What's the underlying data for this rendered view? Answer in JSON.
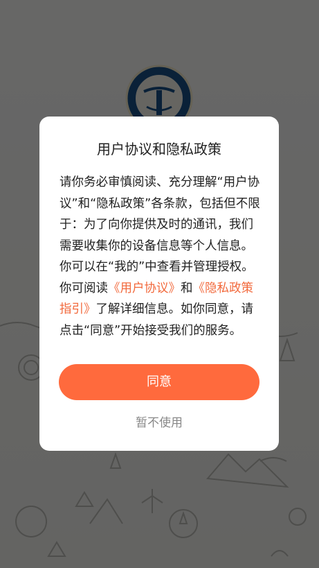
{
  "dialog": {
    "title": "用户协议和隐私政策",
    "body_part1": "请你务必审慎阅读、充分理解“用户协议”和“隐私政策”各条款，包括但不限于：为了向你提供及时的通讯，我们需要收集你的设备信息等个人信息。你可以在“我的”中查看并管理授权。你可阅读",
    "link_user_agreement": "《用户协议》",
    "connector_and": "和",
    "link_privacy_guide": "《隐私政策指引》",
    "body_part2": "了解详细信息。如你同意，请点击“同意”开始接受我们的服务。",
    "agree_label": "同意",
    "decline_label": "暂不使用",
    "accent_color": "#ff6a3d",
    "link_color": "#f26a3d"
  },
  "background": {
    "logo_icon": "circular-seal-logo",
    "pattern": "outdoor-line-art-pattern"
  }
}
